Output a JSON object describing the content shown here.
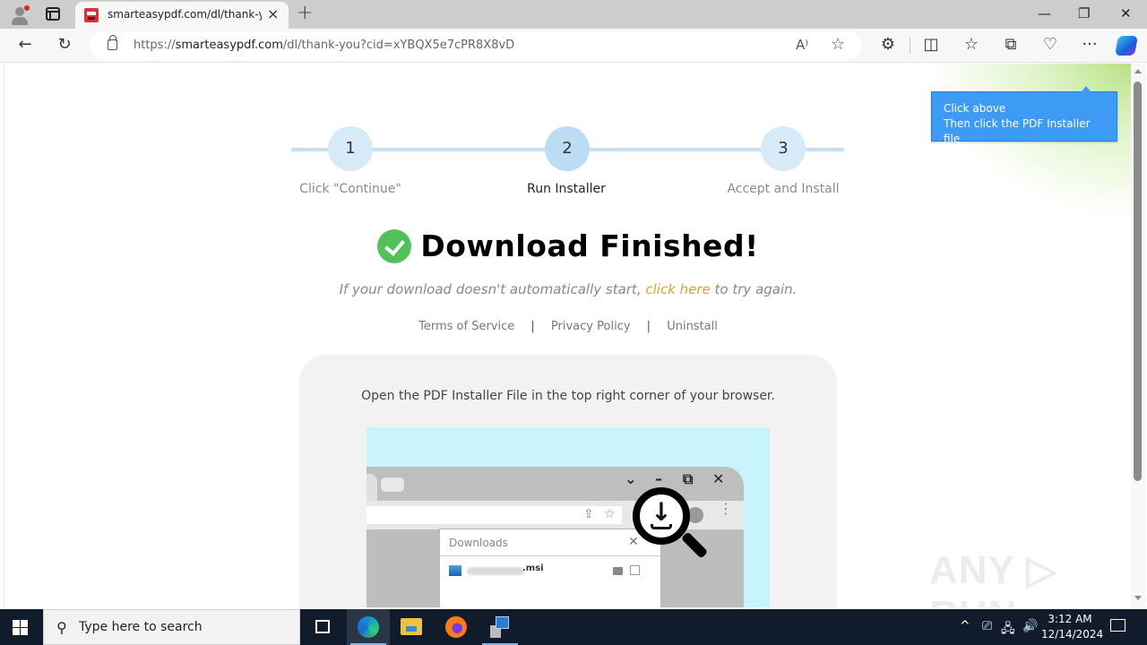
{
  "browser": {
    "tab": {
      "title": "smarteasypdf.com/dl/thank-you",
      "close_icon": "×"
    },
    "new_tab_icon": "+",
    "window_controls": {
      "minimize": "—",
      "restore": "❐",
      "close": "✕"
    },
    "nav": {
      "back_icon": "←",
      "refresh_icon": "↻"
    },
    "address": {
      "scheme": "https://",
      "host": "smarteasypdf.com",
      "path": "/dl/thank-you?cid=xYBQX5e7cPR8X8vD",
      "read_aloud_icon": "A⁾",
      "favorite_icon": "☆"
    },
    "toolbar_icons": {
      "extensions": "⚙",
      "split_screen": "◫",
      "favorites": "☆",
      "collections": "⧉",
      "browser_essentials": "♡",
      "more": "···"
    }
  },
  "page": {
    "tooltip": {
      "line1": "Click above",
      "line2": "Then click the PDF Installer file"
    },
    "steps": [
      {
        "number": "1",
        "label": "Click \"Continue\"",
        "active": false
      },
      {
        "number": "2",
        "label": "Run Installer",
        "active": true
      },
      {
        "number": "3",
        "label": "Accept and Install",
        "active": false
      }
    ],
    "headline": "Download Finished!",
    "retry": {
      "before": "If your download doesn't automatically start, ",
      "link": "click here",
      "after": " to try again."
    },
    "footer_links": {
      "terms": "Terms of Service",
      "privacy": "Privacy Policy",
      "uninstall": "Uninstall",
      "separator": "|"
    },
    "card": {
      "instruction": "Open the PDF Installer File in the top right corner of your browser.",
      "illustration": {
        "window_controls": {
          "dropdown": "⌄",
          "minimize": "–",
          "restore": "⧉",
          "close": "✕"
        },
        "share_icon": "⇪",
        "star_icon": "☆",
        "dots_icon": "⋮",
        "downloads_title": "Downloads",
        "downloads_close": "✕",
        "file_name_suffix": ".msi",
        "download_arrow": "↓"
      }
    },
    "watermark": "ANY ▷ RUN",
    "accent_colors": {
      "tooltip": "#3d9bf5",
      "check": "#52c15b",
      "link": "#e0a030",
      "step": "#d6eaf8"
    }
  },
  "taskbar": {
    "search_placeholder": "Type here to search",
    "search_icon": "⚲",
    "tray": {
      "chevron": "^",
      "meet": "⎚",
      "network": "🖧",
      "volume": "🔊"
    },
    "time": "3:12 AM",
    "date": "12/14/2024"
  }
}
